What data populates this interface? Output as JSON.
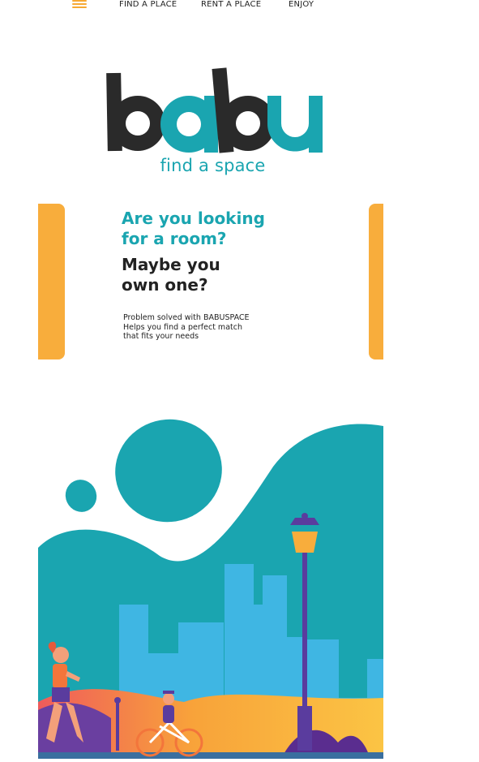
{
  "nav": {
    "menu_icon": "hamburger-menu-icon",
    "links": [
      "FIND A PLACE",
      "RENT A PLACE",
      "ENJOY"
    ]
  },
  "logo": {
    "letters": [
      "b",
      "a",
      "b",
      "u"
    ],
    "tagline": "find a space"
  },
  "intro": {
    "question_line1": "Are you looking",
    "question_line2": "for a room?",
    "sub_line1": "Maybe you",
    "sub_line2": "own one?",
    "desc_line1": "Problem solved with BABUSPACE",
    "desc_line2": "Helps you find a perfect match",
    "desc_line3": "that fits your needs"
  },
  "colors": {
    "teal": "#1aa5b0",
    "orange": "#f8ad3c",
    "dark": "#222222",
    "sky": "#3fb6e3"
  }
}
